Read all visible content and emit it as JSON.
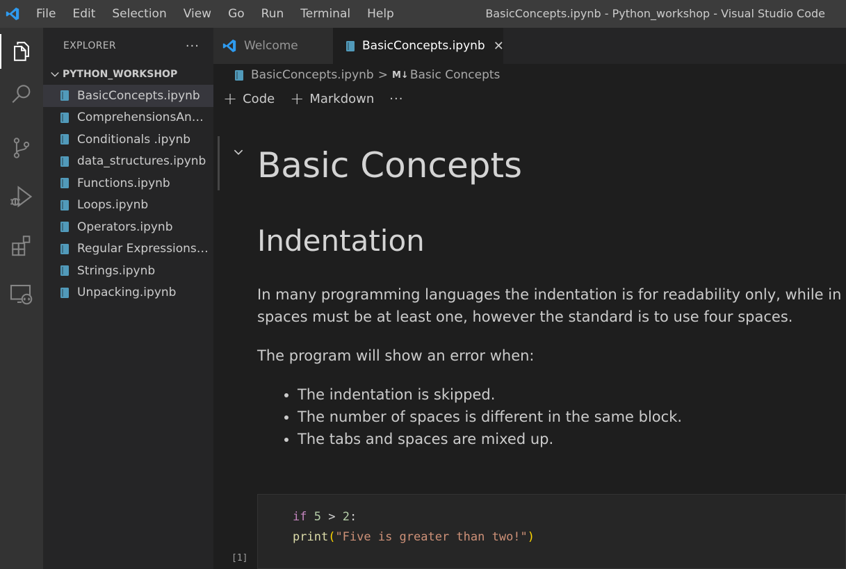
{
  "menu": [
    "File",
    "Edit",
    "Selection",
    "View",
    "Go",
    "Run",
    "Terminal",
    "Help"
  ],
  "window_title": "BasicConcepts.ipynb - Python_workshop - Visual Studio Code",
  "activity": [
    "explorer-icon",
    "search-icon",
    "source-control-icon",
    "run-debug-icon",
    "extensions-icon",
    "remote-explorer-icon"
  ],
  "sidebar": {
    "header": "EXPLORER",
    "more": "···",
    "section": "PYTHON_WORKSHOP",
    "files": [
      "BasicConcepts.ipynb",
      "ComprehensionsAnd...",
      "Conditionals .ipynb",
      "data_structures.ipynb",
      "Functions.ipynb",
      "Loops.ipynb",
      "Operators.ipynb",
      "Regular Expressions.i...",
      "Strings.ipynb",
      "Unpacking.ipynb"
    ]
  },
  "tabs": {
    "welcome": "Welcome",
    "active": "BasicConcepts.ipynb",
    "close": "✕"
  },
  "breadcrumb": {
    "file": "BasicConcepts.ipynb",
    "sep": ">",
    "md_badge": "M↓",
    "section": "Basic Concepts"
  },
  "toolbar": {
    "code": "Code",
    "markdown": "Markdown",
    "more": "···"
  },
  "notebook": {
    "h1": "Basic Concepts",
    "h2": "Indentation",
    "p1_line1": "In many programming languages the indentation is for readability only, while in",
    "p1_line2": "spaces must be at least one, however the standard is to use four spaces.",
    "p2": "The program will show an error when:",
    "bullets": [
      "The indentation is skipped.",
      "The number of spaces is different in the same block.",
      "The tabs and spaces are mixed up."
    ],
    "code": {
      "l1_kw": "if",
      "l1_n1": "5",
      "l1_op": " > ",
      "l1_n2": "2",
      "l1_colon": ":",
      "l2_fn": "print",
      "l2_open": "(",
      "l2_str": "\"Five is greater than two!\"",
      "l2_close": ")"
    },
    "exec_count": "[1]"
  }
}
